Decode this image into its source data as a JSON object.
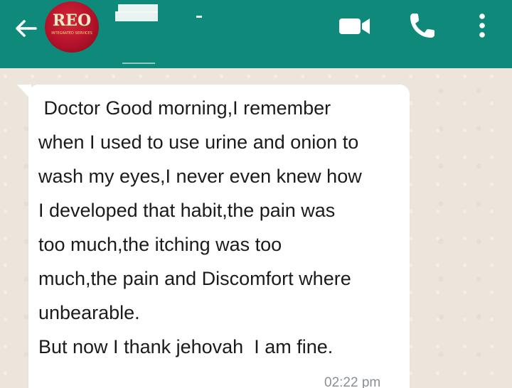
{
  "header": {
    "avatar": {
      "title": "REO",
      "subtitle": "INTEGRATED SERVICES"
    },
    "icons": {
      "back": "arrow-left-icon",
      "video": "video-camera-icon",
      "call": "phone-icon",
      "menu": "more-vertical-icon"
    },
    "colors": {
      "header_bg": "#0f8a7a",
      "icon": "#ffffff"
    }
  },
  "message": {
    "lines": [
      " Doctor Good morning,I remember",
      "when I used to use urine and onion to",
      "wash my eyes,I never even knew how",
      "I developed that habit,the pain was",
      "too much,the itching was too",
      "much,the pain and Discomfort where",
      "unbearable.",
      "But now I thank jehovah  I am fine."
    ],
    "time": "02:22 pm"
  }
}
